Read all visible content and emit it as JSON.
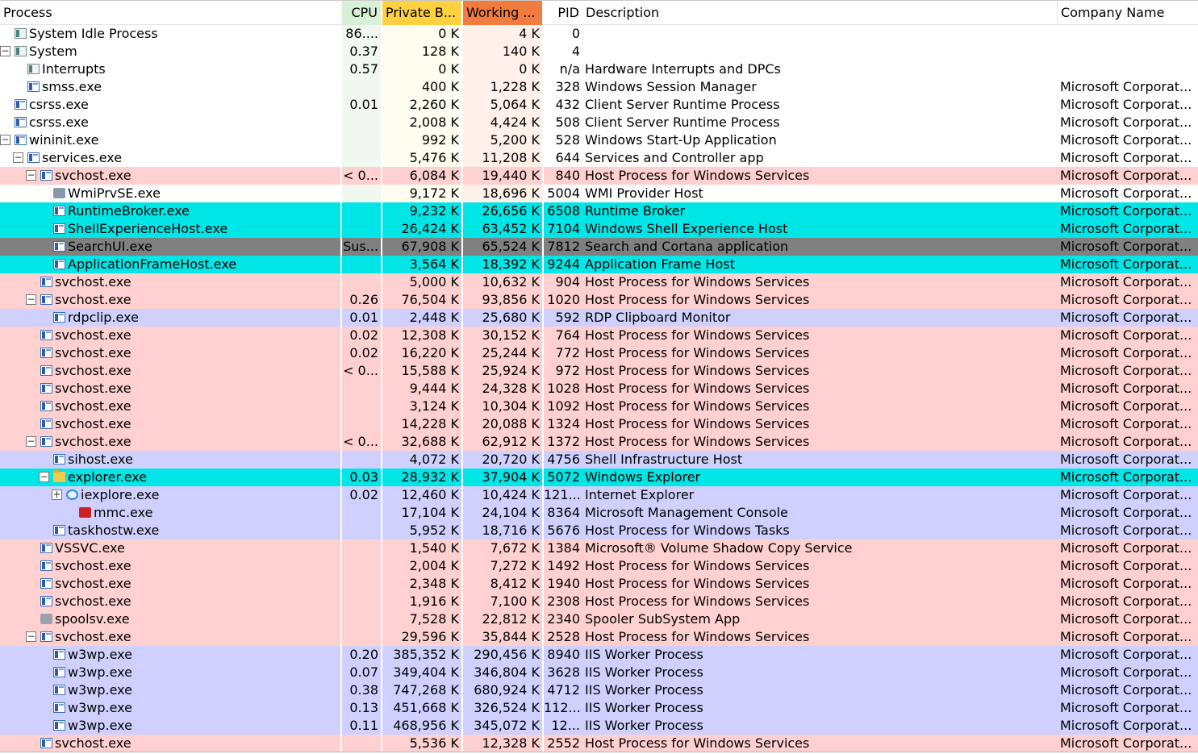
{
  "headers": {
    "process": "Process",
    "cpu": "CPU",
    "private_bytes": "Private B...",
    "working_set": "Working ...",
    "pid": "PID",
    "description": "Description",
    "company": "Company Name"
  },
  "colors": {
    "cpu_header": "#d8f0d8",
    "cpu_column": "#f0f8f0",
    "private_header": "#ffd040",
    "private_column": "#fffcf0",
    "working_header": "#f07c40",
    "working_column": "#fff1ea",
    "service_row": "#ffd0d0",
    "own_process_row": "#d0d0ff",
    "immersive_row": "#00e5e5",
    "suspended_row": "#808080"
  },
  "processes": [
    {
      "name": "System Idle Process",
      "depth": 0,
      "expander": "",
      "icon": "gray-process-icon",
      "cpu": "86....",
      "private": "0 K",
      "working": "4 K",
      "pid": "0",
      "description": "",
      "company": "",
      "highlight": "none"
    },
    {
      "name": "System",
      "depth": 0,
      "expander": "minus",
      "icon": "gray-process-icon",
      "cpu": "0.37",
      "private": "128 K",
      "working": "140 K",
      "pid": "4",
      "description": "",
      "company": "",
      "highlight": "none"
    },
    {
      "name": "Interrupts",
      "depth": 1,
      "expander": "",
      "icon": "gray-process-icon",
      "cpu": "0.57",
      "private": "0 K",
      "working": "0 K",
      "pid": "n/a",
      "description": "Hardware Interrupts and DPCs",
      "company": "",
      "highlight": "none"
    },
    {
      "name": "smss.exe",
      "depth": 1,
      "expander": "",
      "icon": "app-window-icon",
      "cpu": "",
      "private": "400 K",
      "working": "1,228 K",
      "pid": "328",
      "description": "Windows Session Manager",
      "company": "Microsoft Corporat...",
      "highlight": "none"
    },
    {
      "name": "csrss.exe",
      "depth": 0,
      "expander": "",
      "icon": "app-window-icon",
      "cpu": "0.01",
      "private": "2,260 K",
      "working": "5,064 K",
      "pid": "432",
      "description": "Client Server Runtime Process",
      "company": "Microsoft Corporat...",
      "highlight": "none"
    },
    {
      "name": "csrss.exe",
      "depth": 0,
      "expander": "",
      "icon": "app-window-icon",
      "cpu": "",
      "private": "2,008 K",
      "working": "4,424 K",
      "pid": "508",
      "description": "Client Server Runtime Process",
      "company": "Microsoft Corporat...",
      "highlight": "none"
    },
    {
      "name": "wininit.exe",
      "depth": 0,
      "expander": "minus",
      "icon": "app-window-icon",
      "cpu": "",
      "private": "992 K",
      "working": "5,200 K",
      "pid": "528",
      "description": "Windows Start-Up Application",
      "company": "Microsoft Corporat...",
      "highlight": "none"
    },
    {
      "name": "services.exe",
      "depth": 1,
      "expander": "minus",
      "icon": "app-window-icon",
      "cpu": "",
      "private": "5,476 K",
      "working": "11,208 K",
      "pid": "644",
      "description": "Services and Controller app",
      "company": "Microsoft Corporat...",
      "highlight": "none"
    },
    {
      "name": "svchost.exe",
      "depth": 2,
      "expander": "minus",
      "icon": "app-window-icon",
      "cpu": "< 0...",
      "private": "6,084 K",
      "working": "19,440 K",
      "pid": "840",
      "description": "Host Process for Windows Services",
      "company": "Microsoft Corporat...",
      "highlight": "service"
    },
    {
      "name": "WmiPrvSE.exe",
      "depth": 3,
      "expander": "",
      "icon": "wmi-icon",
      "cpu": "",
      "private": "9,172 K",
      "working": "18,696 K",
      "pid": "5004",
      "description": "WMI Provider Host",
      "company": "Microsoft Corporat...",
      "highlight": "none"
    },
    {
      "name": "RuntimeBroker.exe",
      "depth": 3,
      "expander": "",
      "icon": "app-window-icon",
      "cpu": "",
      "private": "9,232 K",
      "working": "26,656 K",
      "pid": "6508",
      "description": "Runtime Broker",
      "company": "Microsoft Corporat...",
      "highlight": "immersive"
    },
    {
      "name": "ShellExperienceHost.exe",
      "depth": 3,
      "expander": "",
      "icon": "app-window-icon",
      "cpu": "",
      "private": "26,424 K",
      "working": "63,452 K",
      "pid": "7104",
      "description": "Windows Shell Experience Host",
      "company": "Microsoft Corporat...",
      "highlight": "immersive"
    },
    {
      "name": "SearchUI.exe",
      "depth": 3,
      "expander": "",
      "icon": "app-window-icon",
      "cpu": "Sus...",
      "private": "67,908 K",
      "working": "65,524 K",
      "pid": "7812",
      "description": "Search and Cortana application",
      "company": "Microsoft Corporat...",
      "highlight": "suspended"
    },
    {
      "name": "ApplicationFrameHost.exe",
      "depth": 3,
      "expander": "",
      "icon": "app-window-icon",
      "cpu": "",
      "private": "3,564 K",
      "working": "18,392 K",
      "pid": "9244",
      "description": "Application Frame Host",
      "company": "Microsoft Corporat...",
      "highlight": "immersive"
    },
    {
      "name": "svchost.exe",
      "depth": 2,
      "expander": "",
      "icon": "app-window-icon",
      "cpu": "",
      "private": "5,000 K",
      "working": "10,632 K",
      "pid": "904",
      "description": "Host Process for Windows Services",
      "company": "Microsoft Corporat...",
      "highlight": "service"
    },
    {
      "name": "svchost.exe",
      "depth": 2,
      "expander": "minus",
      "icon": "app-window-icon",
      "cpu": "0.26",
      "private": "76,504 K",
      "working": "93,856 K",
      "pid": "1020",
      "description": "Host Process for Windows Services",
      "company": "Microsoft Corporat...",
      "highlight": "service"
    },
    {
      "name": "rdpclip.exe",
      "depth": 3,
      "expander": "",
      "icon": "app-window-icon",
      "cpu": "0.01",
      "private": "2,448 K",
      "working": "25,680 K",
      "pid": "592",
      "description": "RDP Clipboard Monitor",
      "company": "Microsoft Corporat...",
      "highlight": "own"
    },
    {
      "name": "svchost.exe",
      "depth": 2,
      "expander": "",
      "icon": "app-window-icon",
      "cpu": "0.02",
      "private": "12,308 K",
      "working": "30,152 K",
      "pid": "764",
      "description": "Host Process for Windows Services",
      "company": "Microsoft Corporat...",
      "highlight": "service"
    },
    {
      "name": "svchost.exe",
      "depth": 2,
      "expander": "",
      "icon": "app-window-icon",
      "cpu": "0.02",
      "private": "16,220 K",
      "working": "25,244 K",
      "pid": "772",
      "description": "Host Process for Windows Services",
      "company": "Microsoft Corporat...",
      "highlight": "service"
    },
    {
      "name": "svchost.exe",
      "depth": 2,
      "expander": "",
      "icon": "app-window-icon",
      "cpu": "< 0...",
      "private": "15,588 K",
      "working": "25,924 K",
      "pid": "972",
      "description": "Host Process for Windows Services",
      "company": "Microsoft Corporat...",
      "highlight": "service"
    },
    {
      "name": "svchost.exe",
      "depth": 2,
      "expander": "",
      "icon": "app-window-icon",
      "cpu": "",
      "private": "9,444 K",
      "working": "24,328 K",
      "pid": "1028",
      "description": "Host Process for Windows Services",
      "company": "Microsoft Corporat...",
      "highlight": "service"
    },
    {
      "name": "svchost.exe",
      "depth": 2,
      "expander": "",
      "icon": "app-window-icon",
      "cpu": "",
      "private": "3,124 K",
      "working": "10,304 K",
      "pid": "1092",
      "description": "Host Process for Windows Services",
      "company": "Microsoft Corporat...",
      "highlight": "service"
    },
    {
      "name": "svchost.exe",
      "depth": 2,
      "expander": "",
      "icon": "app-window-icon",
      "cpu": "",
      "private": "14,228 K",
      "working": "20,088 K",
      "pid": "1324",
      "description": "Host Process for Windows Services",
      "company": "Microsoft Corporat...",
      "highlight": "service"
    },
    {
      "name": "svchost.exe",
      "depth": 2,
      "expander": "minus",
      "icon": "app-window-icon",
      "cpu": "< 0...",
      "private": "32,688 K",
      "working": "62,912 K",
      "pid": "1372",
      "description": "Host Process for Windows Services",
      "company": "Microsoft Corporat...",
      "highlight": "service"
    },
    {
      "name": "sihost.exe",
      "depth": 3,
      "expander": "",
      "icon": "app-window-icon",
      "cpu": "",
      "private": "4,072 K",
      "working": "20,720 K",
      "pid": "4756",
      "description": "Shell Infrastructure Host",
      "company": "Microsoft Corporat...",
      "highlight": "own"
    },
    {
      "name": "explorer.exe",
      "depth": 3,
      "expander": "minus",
      "icon": "folder-icon",
      "cpu": "0.03",
      "private": "28,932 K",
      "working": "37,904 K",
      "pid": "5072",
      "description": "Windows Explorer",
      "company": "Microsoft Corporat...",
      "highlight": "immersive"
    },
    {
      "name": "iexplore.exe",
      "depth": 4,
      "expander": "plus",
      "icon": "internet-explorer-icon",
      "cpu": "0.02",
      "private": "12,460 K",
      "working": "10,424 K",
      "pid": "121...",
      "description": "Internet Explorer",
      "company": "Microsoft Corporat...",
      "highlight": "own"
    },
    {
      "name": "mmc.exe",
      "depth": 5,
      "expander": "",
      "icon": "mmc-icon",
      "cpu": "",
      "private": "17,104 K",
      "working": "24,104 K",
      "pid": "8364",
      "description": "Microsoft Management Console",
      "company": "Microsoft Corporat...",
      "highlight": "own"
    },
    {
      "name": "taskhostw.exe",
      "depth": 3,
      "expander": "",
      "icon": "app-window-icon",
      "cpu": "",
      "private": "5,952 K",
      "working": "18,716 K",
      "pid": "5676",
      "description": "Host Process for Windows Tasks",
      "company": "Microsoft Corporat...",
      "highlight": "own"
    },
    {
      "name": "VSSVC.exe",
      "depth": 2,
      "expander": "",
      "icon": "app-window-icon",
      "cpu": "",
      "private": "1,540 K",
      "working": "7,672 K",
      "pid": "1384",
      "description": "Microsoft® Volume Shadow Copy Service",
      "company": "Microsoft Corporat...",
      "highlight": "service"
    },
    {
      "name": "svchost.exe",
      "depth": 2,
      "expander": "",
      "icon": "app-window-icon",
      "cpu": "",
      "private": "2,004 K",
      "working": "7,272 K",
      "pid": "1492",
      "description": "Host Process for Windows Services",
      "company": "Microsoft Corporat...",
      "highlight": "service"
    },
    {
      "name": "svchost.exe",
      "depth": 2,
      "expander": "",
      "icon": "app-window-icon",
      "cpu": "",
      "private": "2,348 K",
      "working": "8,412 K",
      "pid": "1940",
      "description": "Host Process for Windows Services",
      "company": "Microsoft Corporat...",
      "highlight": "service"
    },
    {
      "name": "svchost.exe",
      "depth": 2,
      "expander": "",
      "icon": "app-window-icon",
      "cpu": "",
      "private": "1,916 K",
      "working": "7,100 K",
      "pid": "2308",
      "description": "Host Process for Windows Services",
      "company": "Microsoft Corporat...",
      "highlight": "service"
    },
    {
      "name": "spoolsv.exe",
      "depth": 2,
      "expander": "",
      "icon": "printer-icon",
      "cpu": "",
      "private": "7,528 K",
      "working": "22,812 K",
      "pid": "2340",
      "description": "Spooler SubSystem App",
      "company": "Microsoft Corporat...",
      "highlight": "service"
    },
    {
      "name": "svchost.exe",
      "depth": 2,
      "expander": "minus",
      "icon": "app-window-icon",
      "cpu": "",
      "private": "29,596 K",
      "working": "35,844 K",
      "pid": "2528",
      "description": "Host Process for Windows Services",
      "company": "Microsoft Corporat...",
      "highlight": "service"
    },
    {
      "name": "w3wp.exe",
      "depth": 3,
      "expander": "",
      "icon": "app-window-icon",
      "cpu": "0.20",
      "private": "385,352 K",
      "working": "290,456 K",
      "pid": "8940",
      "description": "IIS Worker Process",
      "company": "Microsoft Corporat...",
      "highlight": "own"
    },
    {
      "name": "w3wp.exe",
      "depth": 3,
      "expander": "",
      "icon": "app-window-icon",
      "cpu": "0.07",
      "private": "349,404 K",
      "working": "346,804 K",
      "pid": "3628",
      "description": "IIS Worker Process",
      "company": "Microsoft Corporat...",
      "highlight": "own"
    },
    {
      "name": "w3wp.exe",
      "depth": 3,
      "expander": "",
      "icon": "app-window-icon",
      "cpu": "0.38",
      "private": "747,268 K",
      "working": "680,924 K",
      "pid": "4712",
      "description": "IIS Worker Process",
      "company": "Microsoft Corporat...",
      "highlight": "own"
    },
    {
      "name": "w3wp.exe",
      "depth": 3,
      "expander": "",
      "icon": "app-window-icon",
      "cpu": "0.13",
      "private": "451,668 K",
      "working": "326,524 K",
      "pid": "112...",
      "description": "IIS Worker Process",
      "company": "Microsoft Corporat...",
      "highlight": "own"
    },
    {
      "name": "w3wp.exe",
      "depth": 3,
      "expander": "",
      "icon": "app-window-icon",
      "cpu": "0.11",
      "private": "468,956 K",
      "working": "345,072 K",
      "pid": "12...",
      "description": "IIS Worker Process",
      "company": "Microsoft Corporat...",
      "highlight": "own"
    },
    {
      "name": "svchost.exe",
      "depth": 2,
      "expander": "",
      "icon": "app-window-icon",
      "cpu": "",
      "private": "5,536 K",
      "working": "12,328 K",
      "pid": "2552",
      "description": "Host Process for Windows Services",
      "company": "Microsoft Corporat...",
      "highlight": "service"
    }
  ]
}
